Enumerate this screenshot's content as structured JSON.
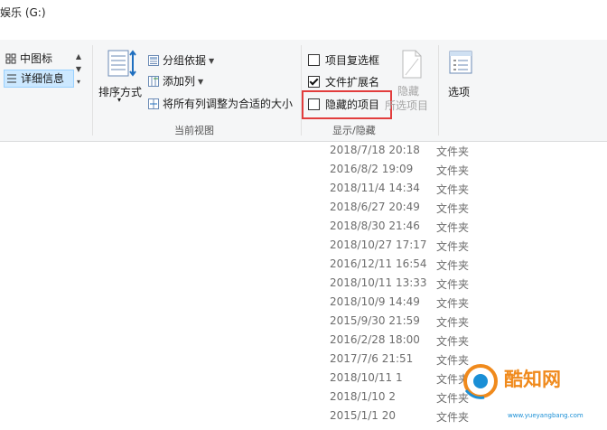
{
  "window": {
    "title": "娱乐 (G:)"
  },
  "ribbon": {
    "layout": {
      "medium_icons": "中图标",
      "details": "详细信息"
    },
    "current_view": {
      "sort_by": "排序方式",
      "group_by": "分组依据",
      "add_columns": "添加列",
      "size_all_columns": "将所有列调整为合适的大小",
      "group_label": "当前视图"
    },
    "show_hide": {
      "item_checkboxes": "项目复选框",
      "file_extensions": "文件扩展名",
      "hidden_items": "隐藏的项目",
      "hide_selected": [
        "隐藏",
        "所选项目"
      ],
      "group_label": "显示/隐藏",
      "states": {
        "item_checkboxes": false,
        "file_extensions": true,
        "hidden_items": false
      }
    },
    "options": "选项"
  },
  "files": [
    {
      "date": "2018/7/18 20:18",
      "type": "文件夹"
    },
    {
      "date": "2016/8/2 19:09",
      "type": "文件夹"
    },
    {
      "date": "2018/11/4 14:34",
      "type": "文件夹"
    },
    {
      "date": "2018/6/27 20:49",
      "type": "文件夹"
    },
    {
      "date": "2018/8/30 21:46",
      "type": "文件夹"
    },
    {
      "date": "2018/10/27 17:17",
      "type": "文件夹"
    },
    {
      "date": "2016/12/11 16:54",
      "type": "文件夹"
    },
    {
      "date": "2018/10/11 13:33",
      "type": "文件夹"
    },
    {
      "date": "2018/10/9 14:49",
      "type": "文件夹"
    },
    {
      "date": "2015/9/30 21:59",
      "type": "文件夹"
    },
    {
      "date": "2016/2/28 18:00",
      "type": "文件夹"
    },
    {
      "date": "2017/7/6 21:51",
      "type": "文件夹"
    },
    {
      "date": "2018/10/11 1",
      "type": "文件夹"
    },
    {
      "date": "2018/1/10 2",
      "type": "文件夹"
    },
    {
      "date": "2015/1/1 20",
      "type": "文件夹"
    }
  ],
  "watermark": {
    "brand": "酷知网",
    "site": "www.yueyangbang.com"
  },
  "colors": {
    "highlight": "#e23d3d",
    "selected": "#cce8ff",
    "watermark_orange": "#f08a1c",
    "watermark_blue": "#1a8fd6"
  }
}
